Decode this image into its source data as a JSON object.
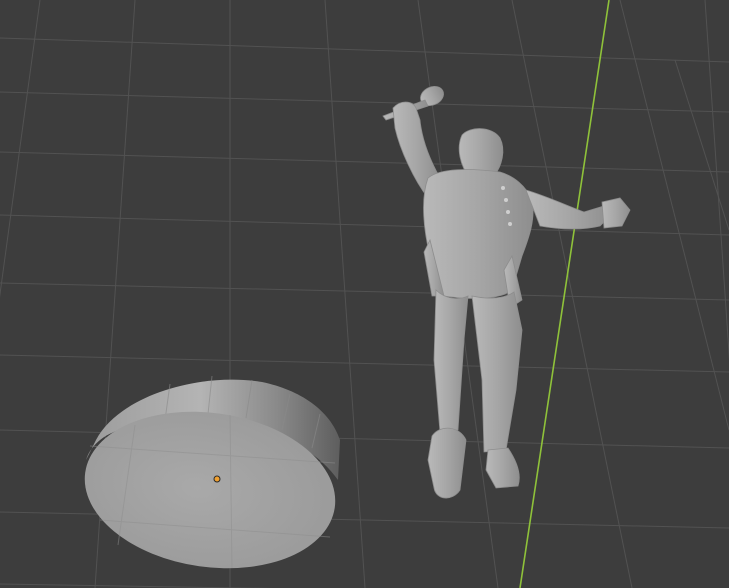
{
  "viewport": {
    "background_color": "#3d3d3d",
    "grid_color": "#545454",
    "axis_y_color": "#8fc23a",
    "mesh_color": "#a8a8a8",
    "origin_dot_color": "#f0a030"
  },
  "objects": [
    {
      "name": "Cylinder",
      "kind": "cylinder-mesh"
    },
    {
      "name": "Figure",
      "kind": "singer-statue-mesh"
    }
  ]
}
